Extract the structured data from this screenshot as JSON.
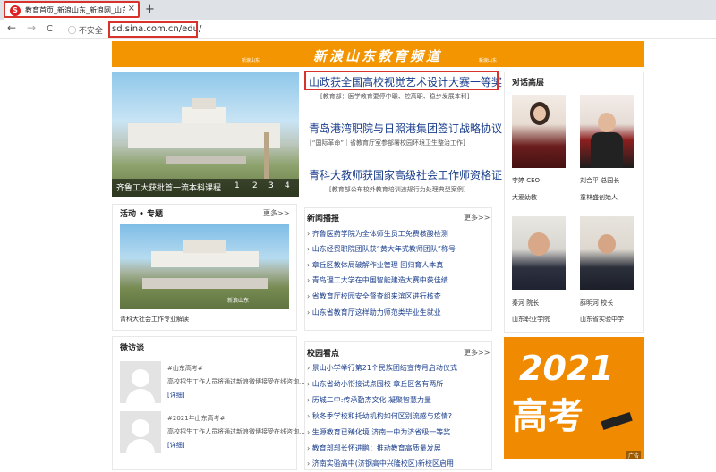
{
  "browser": {
    "tab_title": "教育首页_新浪山东_新浪网_山东",
    "favicon": "sina-weibo-icon",
    "close_glyph": "×",
    "new_tab_glyph": "+",
    "back_glyph": "←",
    "forward_glyph": "→",
    "reload_glyph": "C",
    "info_glyph": "ⓘ",
    "security_label": "不安全",
    "address": "sd.sina.com.cn/edu/"
  },
  "banner": {
    "title": "新浪山东教育频道",
    "logo_left": "新浪山东",
    "logo_right": "新浪山东"
  },
  "carousel": {
    "caption": "齐鲁工大获批首一流本科课程",
    "pages": [
      "1",
      "2",
      "3",
      "4"
    ]
  },
  "headlines": [
    {
      "title": "山政获全国高校视觉艺术设计大赛一等奖",
      "sub": "[教育部：医学教育要停中职、控高职、稳步发展本科]"
    },
    {
      "title": "青岛港湾职院与日照港集团签订战略协议",
      "sub": "[“国际革命”｜省教育厅室参部署校园环境卫生整治工作]"
    },
    {
      "title": "青科大教师获国家高级社会工作师资格证",
      "sub": "[教育部公布校外教育培训违规行为处理典型案例]"
    }
  ],
  "activity": {
    "title": "活动 • 专题",
    "more": "更多>>",
    "caption": "青科大社会工作专业解读"
  },
  "news": {
    "title": "新闻播报",
    "more": "更多>>",
    "items": [
      "齐鲁医药学院为全体师生员工免费核酸检测",
      "山东经贸职院团队获“黄大年式教师团队”称号",
      "章丘区教体局破解作业管理 回归育人本真",
      "青岛理工大学在中国智能建造大赛中获佳绩",
      "省教育厅校园安全督查组来滨区进行核查",
      "山东省教育厅这样助力师范类毕业生就业"
    ]
  },
  "microtalk": {
    "title": "微访谈",
    "items": [
      {
        "tag": "#山东高考#",
        "text": "高校招生工作人员将通过新浪微博接受在线咨询...",
        "link": "[详细]"
      },
      {
        "tag": "#2021年山东高考#",
        "text": "高校招生工作人员将通过新浪微博接受在线咨询...",
        "link": "[详细]"
      }
    ]
  },
  "campus": {
    "title": "校园看点",
    "more": "更多>>",
    "items": [
      "景山小学举行第21个民族团结宣传月启动仪式",
      "山东省幼小衔接试点园校 章丘区各有两所",
      "历城二中:传承勤杰文化 凝聚智慧力量",
      "秋冬季学校和托幼机构如何区别流感与疫情?",
      "生源教育已臻化境 济南一中为济省级一等奖",
      "教育部部长怀进鹏：推动教育高质量发展",
      "济南实验高中(济钢高中兴隆校区)新校区启用"
    ]
  },
  "dialogue": {
    "title": "对话高层",
    "people": [
      {
        "name": "李婷 CEO",
        "org": "大爱幼教"
      },
      {
        "name": "刘合平 总园长",
        "org": "童林盛创始人"
      },
      {
        "name": "秦河 院长",
        "org": "山东职业学院"
      },
      {
        "name": "薛明河 校长",
        "org": "山东省实验中学"
      }
    ]
  },
  "ad": {
    "year": "2021",
    "text": "高考",
    "label": "广告"
  },
  "colors": {
    "accent": "#f39500",
    "highlight_box": "#d8332b",
    "link": "#1a3e8c"
  }
}
